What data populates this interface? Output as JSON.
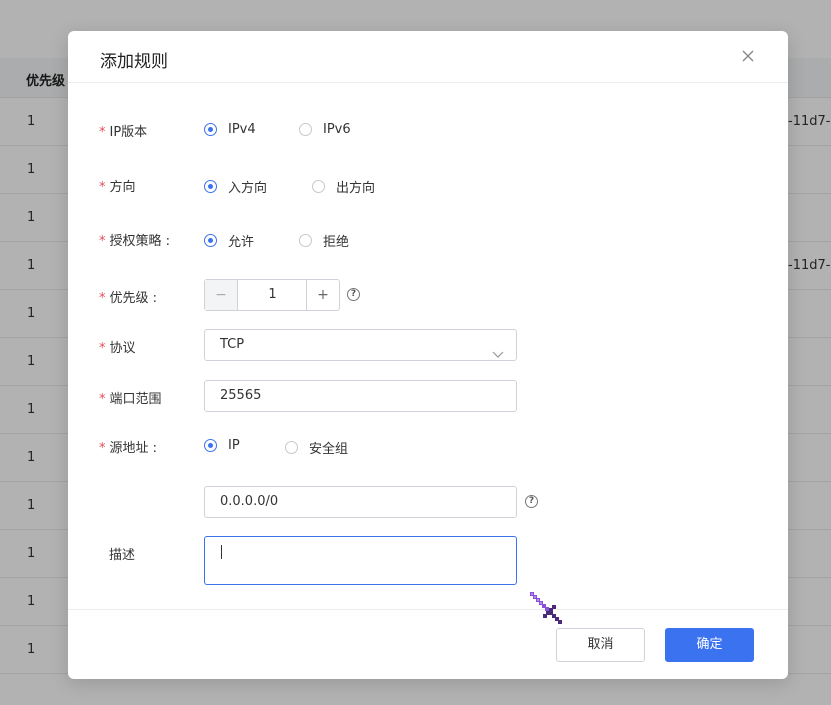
{
  "background_table": {
    "header": "优先级",
    "rows": [
      {
        "priority": "1",
        "suffix": "-11d7-3"
      },
      {
        "priority": "1",
        "suffix": ""
      },
      {
        "priority": "1",
        "suffix": ""
      },
      {
        "priority": "1",
        "suffix": "-11d7-3"
      },
      {
        "priority": "1",
        "suffix": ""
      },
      {
        "priority": "1",
        "suffix": ""
      },
      {
        "priority": "1",
        "suffix": ""
      },
      {
        "priority": "1",
        "suffix": ""
      },
      {
        "priority": "1",
        "suffix": ""
      },
      {
        "priority": "1",
        "suffix": ""
      },
      {
        "priority": "1",
        "suffix": ""
      },
      {
        "priority": "1",
        "suffix": ""
      }
    ]
  },
  "dialog": {
    "title": "添加规则",
    "required_mark": "*",
    "ip_version": {
      "label": "IP版本",
      "options": [
        "IPv4",
        "IPv6"
      ],
      "selected": "IPv4"
    },
    "direction": {
      "label": "方向",
      "options": [
        "入方向",
        "出方向"
      ],
      "selected": "入方向"
    },
    "policy": {
      "label": "授权策略 :",
      "options": [
        "允许",
        "拒绝"
      ],
      "selected": "允许"
    },
    "priority": {
      "label": "优先级 :",
      "value": "1",
      "minus": "−",
      "plus": "+"
    },
    "protocol": {
      "label": "协议",
      "value": "TCP"
    },
    "port_range": {
      "label": "端口范围",
      "value": "25565"
    },
    "source": {
      "label": "源地址 :",
      "options": [
        "IP",
        "安全组"
      ],
      "selected": "IP",
      "value": "0.0.0.0/0"
    },
    "description": {
      "label": "描述",
      "value": ""
    },
    "help_glyph": "?",
    "cancel_label": "取消",
    "ok_label": "确定"
  },
  "colors": {
    "primary": "#3b72f0",
    "required": "#e34d59",
    "cursor": "#8a4fd8"
  }
}
